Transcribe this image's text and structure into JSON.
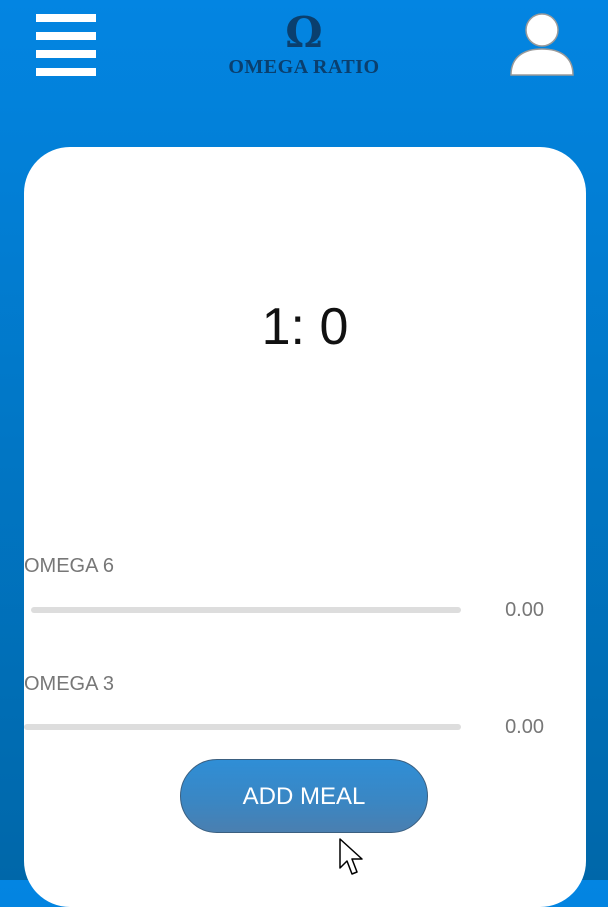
{
  "header": {
    "menu_icon": "hamburger-menu-icon",
    "logo_symbol": "Ω",
    "logo_text": "OMEGA RATIO",
    "profile_icon": "user-avatar-icon"
  },
  "main": {
    "ratio": "1: 0",
    "nutrients": [
      {
        "label": "OMEGA 6",
        "value": "0.00",
        "progress": 0
      },
      {
        "label": "OMEGA 3",
        "value": "0.00",
        "progress": 0
      }
    ],
    "add_meal_label": "ADD MEAL"
  },
  "colors": {
    "background_top": "#0385e2",
    "background_bottom": "#0067a9",
    "logo": "#0a3f6e",
    "button": "#3b86c2",
    "track": "#dddddd"
  }
}
